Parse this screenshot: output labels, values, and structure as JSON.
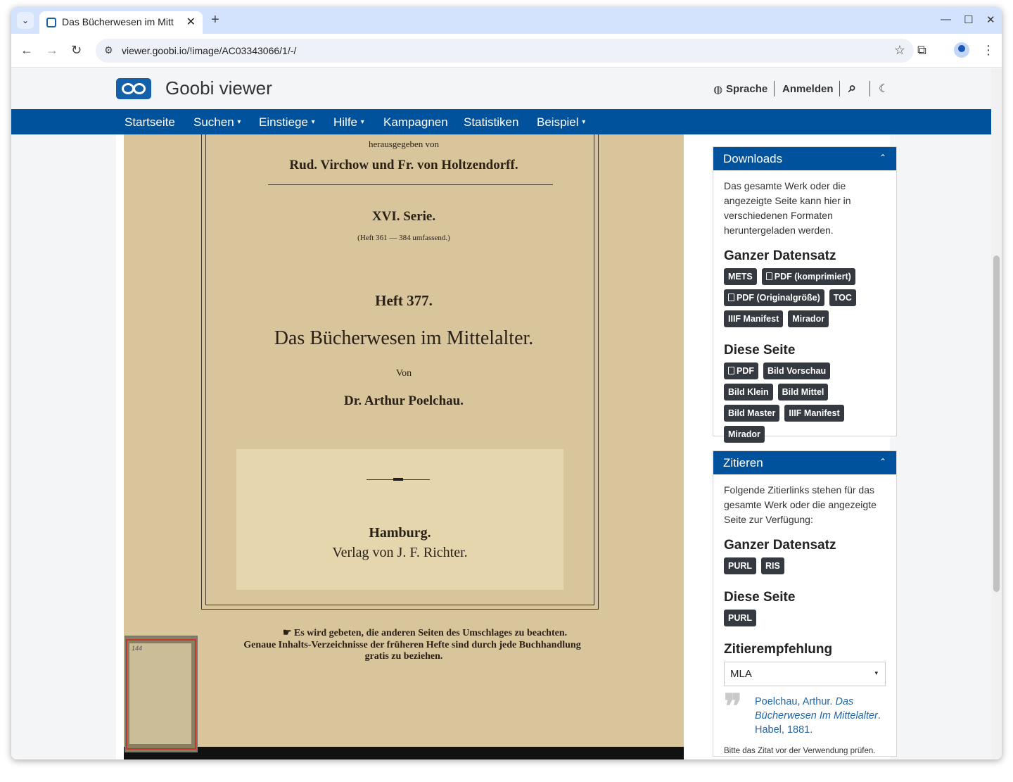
{
  "browser": {
    "tab_title": "Das Bücherwesen im Mitt",
    "tab_close": "✕",
    "new_tab": "+",
    "url": "viewer.goobi.io/!image/AC03343066/1/-/",
    "win_min": "—",
    "win_max": "☐",
    "win_close": "✕",
    "back": "←",
    "forward": "→",
    "reload": "↻",
    "star": "☆",
    "extensions": "⧉",
    "menu": "⋮",
    "tab_menu": "⌄",
    "site_icon": "⚙"
  },
  "header": {
    "brand": "Goobi viewer",
    "language": "Sprache",
    "login": "Anmelden",
    "search_icon": "⌕",
    "darkmode_icon": "☾",
    "globe_icon": "◍"
  },
  "nav": {
    "items": [
      "Startseite",
      "Suchen",
      "Einstiege",
      "Hilfe",
      "Kampagnen",
      "Statistiken",
      "Beispiel"
    ],
    "caret": "▾"
  },
  "document_image": {
    "line1": "herausgegeben von",
    "line2": "Rud. Virchow und Fr. von Holtzendorff.",
    "series": "XVI. Serie.",
    "series_sub": "(Heft 361 — 384 umfassend.)",
    "issue": "Heft 377.",
    "title": "Das Bücherwesen im Mittelalter.",
    "by": "Von",
    "author": "Dr. Arthur Poelchau.",
    "city": "Hamburg.",
    "publisher": "Verlag von J. F. Richter.",
    "note1": "☛ Es wird gebeten, die anderen Seiten des Umschlages zu beachten.",
    "note2": "Genaue Inhalts-Verzeichnisse der früheren Hefte sind durch jede Buchhandlung",
    "note3": "gratis zu beziehen.",
    "minimap_label": "144"
  },
  "downloads": {
    "title": "Downloads",
    "chevron": "⌃",
    "description": "Das gesamte Werk oder die angezeigte Seite kann hier in verschiedenen Formaten heruntergeladen werden.",
    "whole_title": "Ganzer Datensatz",
    "whole_buttons": [
      "METS",
      "PDF (komprimiert)",
      "PDF (Originalgröße)",
      "TOC",
      "IIIF Manifest",
      "Mirador"
    ],
    "page_title": "Diese Seite",
    "page_buttons": [
      "PDF",
      "Bild Vorschau",
      "Bild Klein",
      "Bild Mittel",
      "Bild Master",
      "IIIF Manifest",
      "Mirador"
    ]
  },
  "cite": {
    "title": "Zitieren",
    "chevron": "⌃",
    "description": "Folgende Zitierlinks stehen für das gesamte Werk oder die angezeigte Seite zur Verfügung:",
    "whole_title": "Ganzer Datensatz",
    "whole_buttons": [
      "PURL",
      "RIS"
    ],
    "page_title": "Diese Seite",
    "page_buttons": [
      "PURL"
    ],
    "recommend_title": "Zitierempfehlung",
    "style_selected": "MLA",
    "select_caret": "▾",
    "quote_icon": "❞",
    "citation_author": "Poelchau, Arthur. ",
    "citation_title": "Das Bücherwesen Im Mittelalter",
    "citation_rest": ". Habel, 1881.",
    "note": "Bitte das Zitat vor der Verwendung prüfen."
  }
}
